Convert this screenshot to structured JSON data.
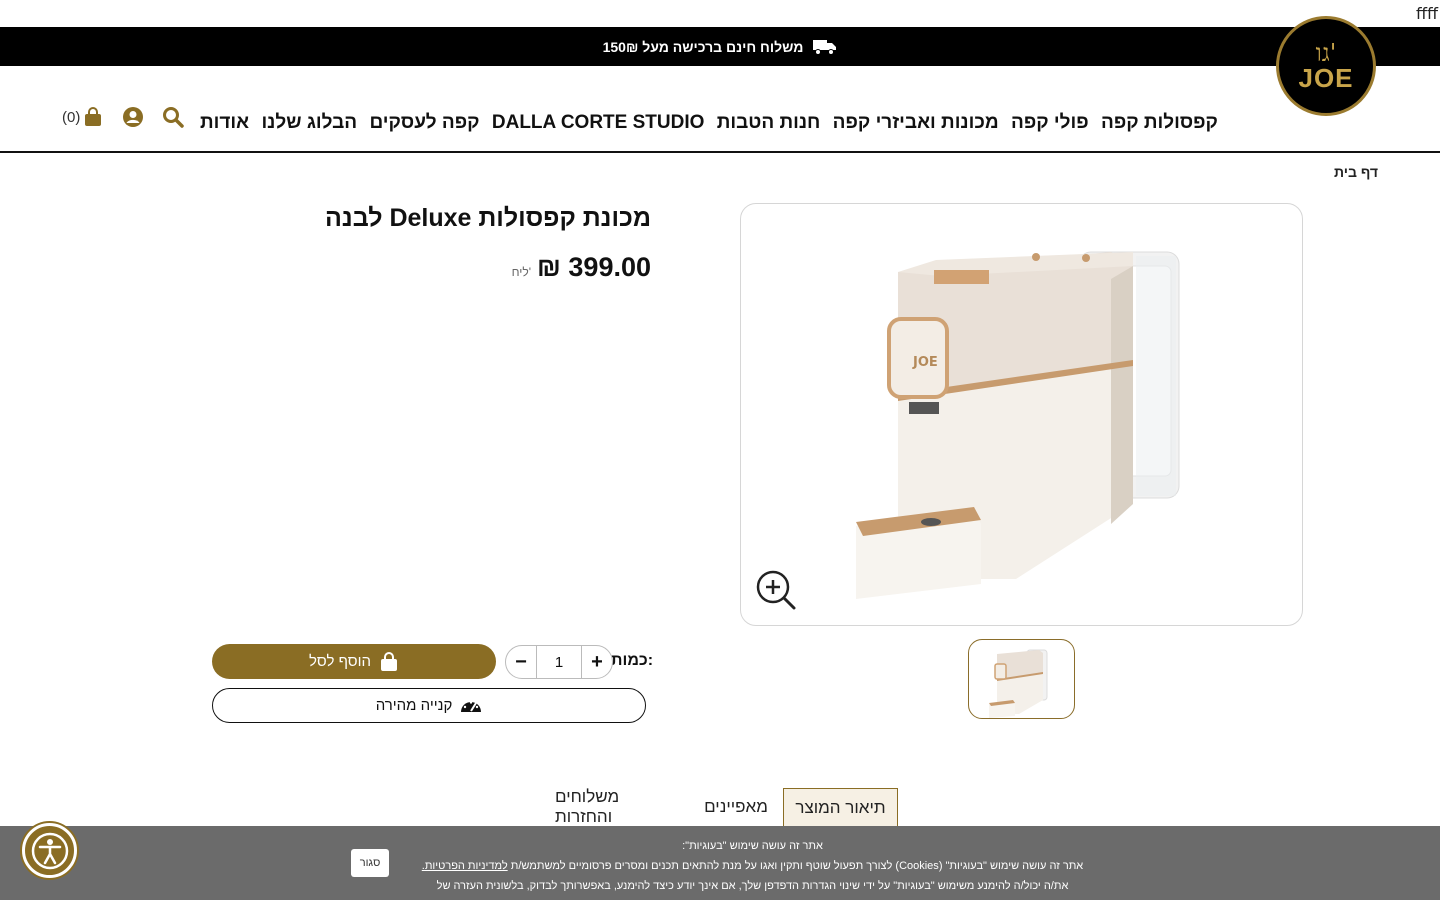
{
  "debug_text": "ffff",
  "topbar": {
    "text": "משלוח חינם ברכישה מעל 150₪"
  },
  "logo": {
    "top": "גו'",
    "bottom": "JOE"
  },
  "nav": {
    "items": [
      {
        "label": "קפסולות קפה"
      },
      {
        "label": "פולי קפה"
      },
      {
        "label": "מכונות ואביזרי קפה"
      },
      {
        "label": "חנות הטבות"
      },
      {
        "label": "DALLA CORTE STUDIO"
      },
      {
        "label": "קפה לעסקים"
      },
      {
        "label": "הבלוג שלנו"
      },
      {
        "label": "אודות"
      }
    ]
  },
  "header_tools": {
    "cart_count": "(0)"
  },
  "breadcrumb": {
    "home": "דף בית"
  },
  "product": {
    "title": "מכונת קפסולות Deluxe לבנה",
    "price": "₪ 399.00",
    "unit": "ליח'",
    "qty_label": "כמות:",
    "qty_value": "1",
    "add_to_cart": "הוסף לסל",
    "quick_buy": "קנייה מהירה"
  },
  "tabs": {
    "description": "תיאור המוצר",
    "features": "מאפיינים",
    "shipping": "משלוחים והחזרות"
  },
  "cookie": {
    "line1": "אתר זה עושה שימוש \"בעוגיות\":",
    "line2_prefix": "אתר זה עושה שימוש \"בעוגיות\" (Cookies) לצורך תפעול שוטף ותקין ואגו על מנת להתאים תכנים ומסרים פרסומיים למשתמש/ת",
    "line2_link": "למדיניות הפרטיות.",
    "line3": "את/ה יכול/ה להימנע משימוש \"בעוגיות\" על ידי שינוי הגדרות הדפדפן שלך, אם אינך יודע כיצד להימנע, באפשרותך לבדוק, בלשונית העזרה של הדפדפן בו אתה משתמש.",
    "close": "סגור"
  },
  "colors": {
    "brand_gold": "#8a6d24",
    "topbar_bg": "#000000",
    "cookie_bg": "#6b6b6b"
  }
}
